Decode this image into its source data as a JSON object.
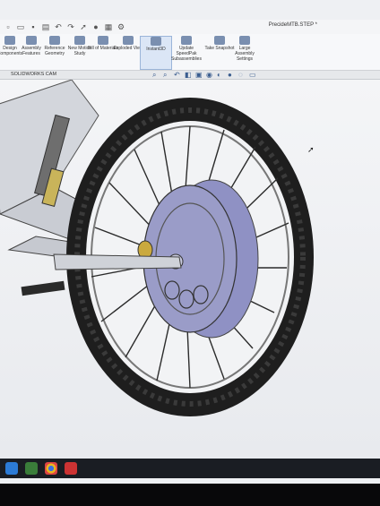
{
  "window": {
    "title": "PrecideMTB.STEP *"
  },
  "ribbon": {
    "buttons": [
      {
        "label": "Design Components"
      },
      {
        "label": "Assembly Features"
      },
      {
        "label": "Reference Geometry"
      },
      {
        "label": "New Motion Study"
      },
      {
        "label": "Bill of Materials"
      },
      {
        "label": "Exploded View"
      },
      {
        "label": "Instant3D"
      },
      {
        "label": "Update SpeedPak Subassemblies"
      },
      {
        "label": "Take Snapshot"
      },
      {
        "label": "Large Assembly Settings"
      }
    ]
  },
  "tabs": [
    {
      "label": "SOLIDWORKS CAM"
    }
  ],
  "colors": {
    "ribbon_icon": "#7a8fb0",
    "hub": "#9a9cc8",
    "tire": "#1e1e1e",
    "frame": "#cfd2d8"
  }
}
